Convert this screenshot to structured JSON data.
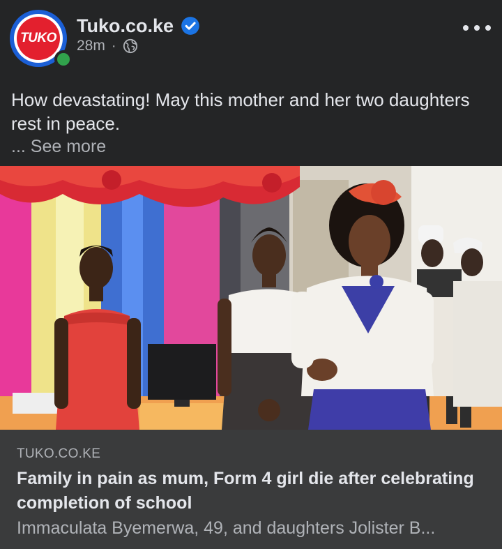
{
  "header": {
    "avatar_label": "TUKO",
    "page_name": "Tuko.co.ke",
    "timestamp": "28m",
    "separator": "·",
    "verified_icon": "verified-badge-icon",
    "privacy_icon": "globe-icon",
    "menu_icon": "more-options-icon"
  },
  "post": {
    "text": "How devastating! May this mother and her two daughters rest in peace.",
    "see_more": "... See more"
  },
  "link_preview": {
    "domain": "TUKO.CO.KE",
    "title": "Family in pain as mum, Form 4 girl die after celebrating completion of school",
    "description": "Immaculata Byemerwa, 49, and daughters Jolister B..."
  },
  "colors": {
    "background": "#242526",
    "link_box": "#3a3b3c",
    "accent_blue": "#1b74e4",
    "brand_red": "#e3202e",
    "online_green": "#31a24c"
  }
}
